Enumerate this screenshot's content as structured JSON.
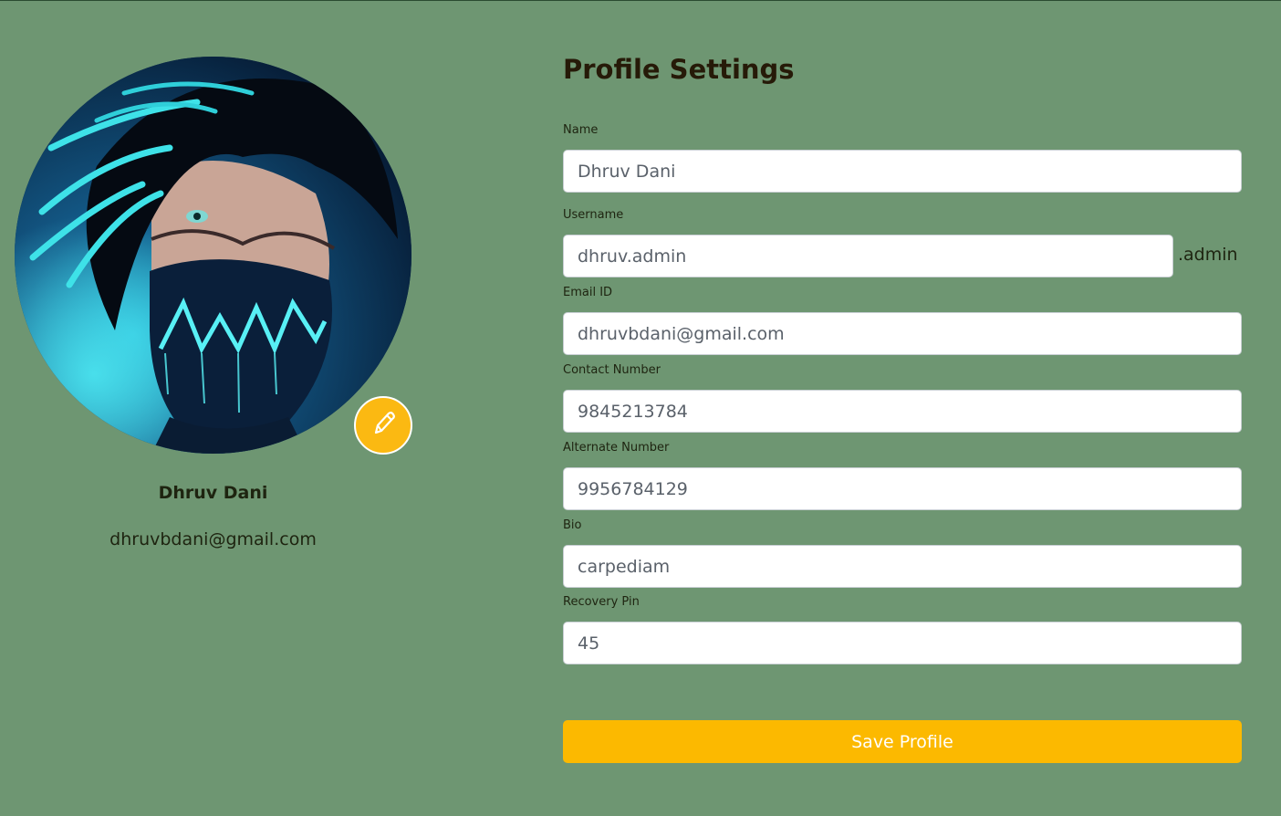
{
  "profile": {
    "name": "Dhruv Dani",
    "email": "dhruvbdani@gmail.com",
    "avatar_alt": "profile-avatar",
    "edit_icon": "pencil-icon"
  },
  "settings": {
    "title": "Profile Settings",
    "fields": {
      "name": {
        "label": "Name",
        "value": "Dhruv Dani"
      },
      "username": {
        "label": "Username",
        "value": "dhruv.admin",
        "suffix": ".admin"
      },
      "email": {
        "label": "Email ID",
        "value": "dhruvbdani@gmail.com"
      },
      "contact": {
        "label": "Contact Number",
        "value": "9845213784"
      },
      "alternate": {
        "label": "Alternate Number",
        "value": "9956784129"
      },
      "bio": {
        "label": "Bio",
        "value": "carpediam"
      },
      "recovery_pin": {
        "label": "Recovery Pin",
        "value": "45"
      }
    },
    "save_label": "Save Profile"
  },
  "colors": {
    "background": "#6e9672",
    "accent": "#fcb900",
    "input_bg": "#ffffff"
  }
}
